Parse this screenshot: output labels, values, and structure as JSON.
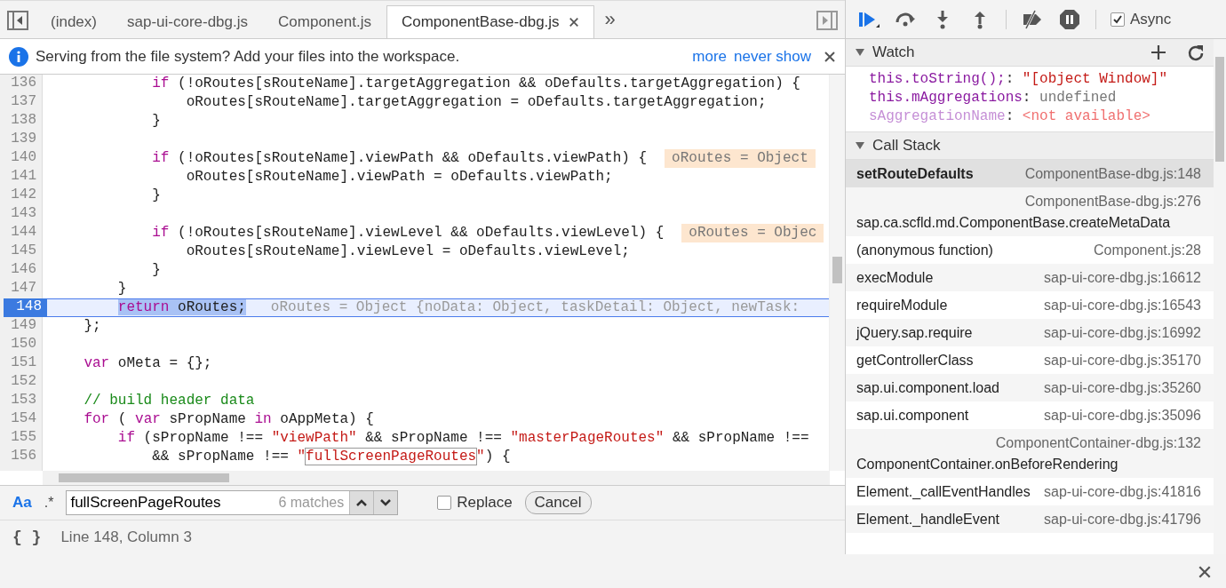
{
  "editor_tabs": [
    {
      "label": "(index)",
      "selected": false,
      "closable": false
    },
    {
      "label": "sap-ui-core-dbg.js",
      "selected": false,
      "closable": false
    },
    {
      "label": "Component.js",
      "selected": false,
      "closable": false
    },
    {
      "label": "ComponentBase-dbg.js",
      "selected": true,
      "closable": true
    }
  ],
  "tabs_overflow": "»",
  "infobar": {
    "message": "Serving from the file system? Add your files into the workspace.",
    "links": [
      "more",
      "never show"
    ]
  },
  "code_lines": [
    {
      "number": "136",
      "current": false,
      "tokens": [
        {
          "kind": "kw",
          "text": "            if"
        },
        {
          "kind": "plain",
          "text": " (!oRoutes[sRouteName].targetAggregation && oDefaults.targetAggregation) {"
        }
      ]
    },
    {
      "number": "137",
      "current": false,
      "tokens": [
        {
          "kind": "plain",
          "text": "                oRoutes[sRouteName].targetAggregation = oDefaults.targetAggregation;"
        }
      ]
    },
    {
      "number": "138",
      "current": false,
      "tokens": [
        {
          "kind": "plain",
          "text": "            }"
        }
      ]
    },
    {
      "number": "139",
      "current": false
    },
    {
      "number": "140",
      "current": false,
      "tokens": [
        {
          "kind": "kw",
          "text": "            if"
        },
        {
          "kind": "plain",
          "text": " (!oRoutes[sRouteName].viewPath && oDefaults.viewPath) {"
        }
      ],
      "inline_value": "oRoutes = Object"
    },
    {
      "number": "141",
      "current": false,
      "tokens": [
        {
          "kind": "plain",
          "text": "                oRoutes[sRouteName].viewPath = oDefaults.viewPath;"
        }
      ]
    },
    {
      "number": "142",
      "current": false,
      "tokens": [
        {
          "kind": "plain",
          "text": "            }"
        }
      ]
    },
    {
      "number": "143",
      "current": false
    },
    {
      "number": "144",
      "current": false,
      "tokens": [
        {
          "kind": "kw",
          "text": "            if"
        },
        {
          "kind": "plain",
          "text": " (!oRoutes[sRouteName].viewLevel && oDefaults.viewLevel) {"
        }
      ],
      "inline_value": "oRoutes = Objec"
    },
    {
      "number": "145",
      "current": false,
      "tokens": [
        {
          "kind": "plain",
          "text": "                oRoutes[sRouteName].viewLevel = oDefaults.viewLevel;"
        }
      ]
    },
    {
      "number": "146",
      "current": false,
      "tokens": [
        {
          "kind": "plain",
          "text": "            }"
        }
      ]
    },
    {
      "number": "147",
      "current": false,
      "tokens": [
        {
          "kind": "plain",
          "text": "        }"
        }
      ]
    },
    {
      "number": "148",
      "current": true,
      "indented": true,
      "tokens": [
        {
          "kind": "kw",
          "text": "return",
          "selected": true
        },
        {
          "kind": "plain",
          "text": " oRoutes;",
          "selected": true
        }
      ],
      "inline_value": "oRoutes = Object {noData: Object, taskDetail: Object, newTask:"
    },
    {
      "number": "149",
      "current": false,
      "tokens": [
        {
          "kind": "plain",
          "text": "    };"
        }
      ]
    },
    {
      "number": "150",
      "current": false
    },
    {
      "number": "151",
      "current": false,
      "tokens": [
        {
          "kind": "kw",
          "text": "    var"
        },
        {
          "kind": "plain",
          "text": " oMeta = {};"
        }
      ]
    },
    {
      "number": "152",
      "current": false
    },
    {
      "number": "153",
      "current": false,
      "tokens": [
        {
          "kind": "com",
          "text": "    // build header data"
        }
      ]
    },
    {
      "number": "154",
      "current": false,
      "tokens": [
        {
          "kind": "kw",
          "text": "    for"
        },
        {
          "kind": "plain",
          "text": " ( "
        },
        {
          "kind": "kw",
          "text": "var"
        },
        {
          "kind": "plain",
          "text": " sPropName "
        },
        {
          "kind": "kw",
          "text": "in"
        },
        {
          "kind": "plain",
          "text": " oAppMeta) {"
        }
      ]
    },
    {
      "number": "155",
      "current": false,
      "tokens": [
        {
          "kind": "kw",
          "text": "        if"
        },
        {
          "kind": "plain",
          "text": " (sPropName !== "
        },
        {
          "kind": "str",
          "text": "\"viewPath\""
        },
        {
          "kind": "plain",
          "text": " && sPropName !== "
        },
        {
          "kind": "str",
          "text": "\"masterPageRoutes\""
        },
        {
          "kind": "plain",
          "text": " && sPropName !=="
        }
      ]
    },
    {
      "number": "156",
      "current": false,
      "tokens": [
        {
          "kind": "plain",
          "text": "            && sPropName !== "
        },
        {
          "kind": "str",
          "text": "\""
        },
        {
          "kind": "match",
          "text": "fullScreenPageRoutes"
        },
        {
          "kind": "str",
          "text": "\""
        },
        {
          "kind": "plain",
          "text": ") {"
        }
      ]
    }
  ],
  "search": {
    "case_toggle": "Aa",
    "case_sensitive": true,
    "regex_toggle": ".*",
    "value": "fullScreenPageRoutes",
    "matches": "6 matches",
    "replace": {
      "label": "Replace",
      "checked": false
    },
    "cancel": "Cancel"
  },
  "status": {
    "pretty_print": "{ }",
    "position": "Line 148, Column 3"
  },
  "debugger": {
    "async": {
      "label": "Async",
      "checked": true
    },
    "watch": {
      "title": "Watch",
      "expanded": true,
      "items": [
        {
          "expression": "this.toString();",
          "separator": ":",
          "value": "\"[object Window]\"",
          "kind": "string"
        },
        {
          "expression": "this.mAggregations",
          "separator": ":",
          "value": "undefined",
          "kind": "undefined"
        },
        {
          "expression": "sAggregationName",
          "separator": ":",
          "value": "<not available>",
          "kind": "unavailable"
        }
      ]
    },
    "call_stack": {
      "title": "Call Stack",
      "expanded": true,
      "frames": [
        {
          "name": "setRouteDefaults",
          "location": "ComponentBase-dbg.js:148",
          "selected": true,
          "kind": "inline"
        },
        {
          "name": "sap.ca.scfld.md.ComponentBase.createMetaData",
          "location": "ComponentBase-dbg.js:276",
          "selected": false,
          "kind": "stacked"
        },
        {
          "name": "(anonymous function)",
          "location": "Component.js:28",
          "selected": false,
          "kind": "inline"
        },
        {
          "name": "execModule",
          "location": "sap-ui-core-dbg.js:16612",
          "selected": false,
          "kind": "inline"
        },
        {
          "name": "requireModule",
          "location": "sap-ui-core-dbg.js:16543",
          "selected": false,
          "kind": "inline"
        },
        {
          "name": "jQuery.sap.require",
          "location": "sap-ui-core-dbg.js:16992",
          "selected": false,
          "kind": "inline"
        },
        {
          "name": "getControllerClass",
          "location": "sap-ui-core-dbg.js:35170",
          "selected": false,
          "kind": "inline"
        },
        {
          "name": "sap.ui.component.load",
          "location": "sap-ui-core-dbg.js:35260",
          "selected": false,
          "kind": "inline"
        },
        {
          "name": "sap.ui.component",
          "location": "sap-ui-core-dbg.js:35096",
          "selected": false,
          "kind": "inline"
        },
        {
          "name": "ComponentContainer.onBeforeRendering",
          "location": "ComponentContainer-dbg.js:132",
          "selected": false,
          "kind": "stacked"
        },
        {
          "name": "Element._callEventHandles",
          "location": "sap-ui-core-dbg.js:41816",
          "selected": false,
          "kind": "inline"
        },
        {
          "name": "Element._handleEvent",
          "location": "sap-ui-core-dbg.js:41796",
          "selected": false,
          "kind": "inline"
        }
      ]
    }
  }
}
